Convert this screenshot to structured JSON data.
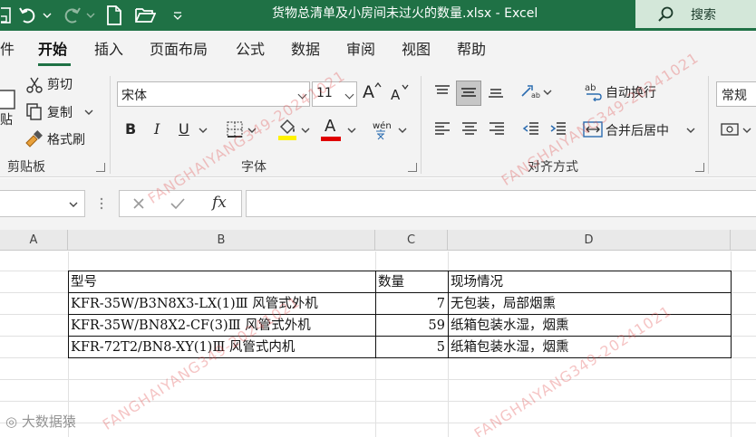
{
  "window": {
    "title": "货物总清单及小房间未过火的数量.xlsx  -  Excel",
    "search_label": "搜索"
  },
  "tabs": [
    {
      "label": "件",
      "active": false
    },
    {
      "label": "开始",
      "active": true
    },
    {
      "label": "插入",
      "active": false
    },
    {
      "label": "页面布局",
      "active": false
    },
    {
      "label": "公式",
      "active": false
    },
    {
      "label": "数据",
      "active": false
    },
    {
      "label": "审阅",
      "active": false
    },
    {
      "label": "视图",
      "active": false
    },
    {
      "label": "帮助",
      "active": false
    }
  ],
  "ribbon": {
    "clipboard": {
      "paste_label": "贴",
      "cut_label": "剪切",
      "copy_label": "复制",
      "format_painter_label": "格式刷",
      "group_label": "剪贴板"
    },
    "font": {
      "font_name": "宋体",
      "font_size": "11",
      "bold_label": "B",
      "italic_label": "I",
      "underline_label": "U",
      "font_color_label": "A",
      "grow_label": "A",
      "shrink_label": "A",
      "phonetic_label": "wén",
      "group_label": "字体"
    },
    "alignment": {
      "wrap_label": "自动换行",
      "merge_label": "合并后居中",
      "group_label": "对齐方式"
    },
    "number": {
      "format": "常规"
    }
  },
  "formula_bar": {
    "fx_label": "fx",
    "value": ""
  },
  "sheet": {
    "columns": [
      "A",
      "B",
      "C",
      "D"
    ],
    "rows": [
      [
        "",
        "型号",
        "数量",
        "现场情况"
      ],
      [
        "",
        "KFR-35W/B3N8X3-LX(1)Ⅲ 风管式外机",
        "7",
        "无包装，局部烟熏"
      ],
      [
        "",
        "KFR-35W/BN8X2-CF(3)Ⅲ 风管式外机",
        "59",
        "纸箱包装水湿，烟熏"
      ],
      [
        "",
        "KFR-72T2/BN8-XY(1)Ⅲ 风管式内机",
        "5",
        "纸箱包装水湿，烟熏"
      ]
    ]
  },
  "watermarks": [
    "FANGHAIYANG349-20241021",
    "FANGHAIYANG349-20241021",
    "FANGHAIYANG349-20241021",
    "FANGHAIYANG349-20241021"
  ],
  "corner_logo": "大数据猿"
}
